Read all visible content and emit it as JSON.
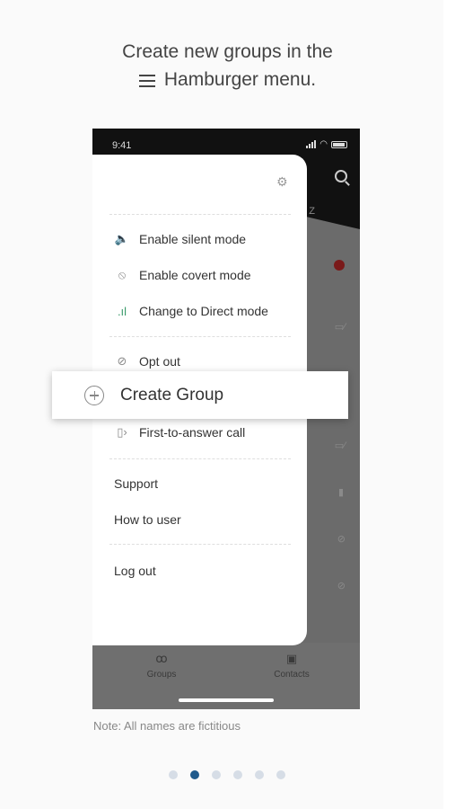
{
  "headline": {
    "line1": "Create new groups in the",
    "line2": "Hamburger menu."
  },
  "status": {
    "time": "9:41"
  },
  "drawer": {
    "items": [
      {
        "label": "Enable silent mode",
        "icon": "speaker-mute-icon"
      },
      {
        "label": "Enable covert mode",
        "icon": "eye-off-icon"
      },
      {
        "label": "Change to Direct mode",
        "icon": "signal-bars-icon"
      },
      {
        "label": "Opt out",
        "icon": "block-icon"
      },
      {
        "label": "First-to-answer call",
        "icon": "phone-forward-icon"
      }
    ],
    "support": "Support",
    "howto": "How to user",
    "logout": "Log out"
  },
  "highlight": {
    "label": "Create Group"
  },
  "nav": {
    "groups": "Groups",
    "contacts": "Contacts"
  },
  "note": "Note: All names are fictitious",
  "pager": {
    "count": 6,
    "active": 2
  },
  "colors": {
    "accent": "#1f5a8c",
    "pager_inactive": "#d6dde6"
  }
}
